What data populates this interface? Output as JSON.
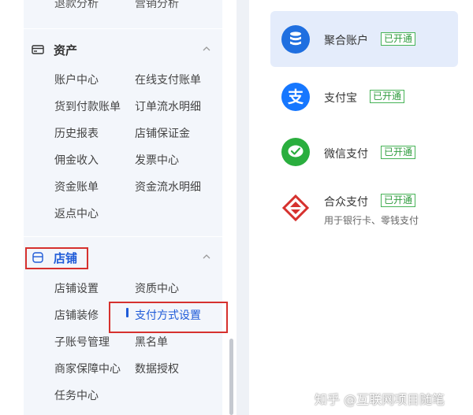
{
  "sidebar": {
    "top_partial": [
      "退款分析",
      "营销分析"
    ],
    "assets": {
      "title": "资产",
      "items": [
        "账户中心",
        "在线支付账单",
        "货到付款账单",
        "订单流水明细",
        "历史报表",
        "店铺保证金",
        "佣金收入",
        "发票中心",
        "资金账单",
        "资金流水明细",
        "返点中心"
      ]
    },
    "store": {
      "title": "店铺",
      "items": [
        "店铺设置",
        "资质中心",
        "店铺装修",
        "支付方式设置",
        "子账号管理",
        "黑名单",
        "商家保障中心",
        "数据授权",
        "任务中心"
      ],
      "active": "支付方式设置"
    }
  },
  "payments": [
    {
      "name": "聚合账户",
      "status": "已开通",
      "subtitle": "",
      "icon": "database-icon",
      "color": "#1f6fe0"
    },
    {
      "name": "支付宝",
      "status": "已开通",
      "subtitle": "",
      "icon": "alipay-icon",
      "color": "#1677ff"
    },
    {
      "name": "微信支付",
      "status": "已开通",
      "subtitle": "",
      "icon": "wechat-pay-icon",
      "color": "#2aae3e"
    },
    {
      "name": "合众支付",
      "status": "已开通",
      "subtitle": "用于银行卡、零钱支付",
      "icon": "hezhong-pay-icon",
      "color": "#d6312e"
    }
  ],
  "colors": {
    "accent": "#1f5bd8",
    "success": "#2e9b3d",
    "highlight_box": "#d6312e"
  },
  "watermark": "知乎 @互联网项目随笔"
}
